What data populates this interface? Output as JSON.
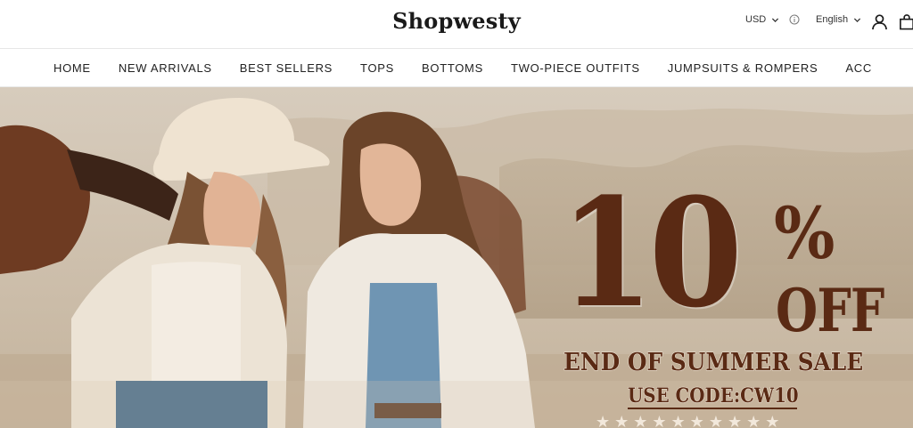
{
  "header": {
    "logo_text": "Shopwesty",
    "currency": "USD",
    "language": "English"
  },
  "nav": {
    "items": [
      {
        "label": "HOME"
      },
      {
        "label": "NEW ARRIVALS"
      },
      {
        "label": "BEST SELLERS"
      },
      {
        "label": "TOPS"
      },
      {
        "label": "BOTTOMS"
      },
      {
        "label": "TWO-PIECE OUTFITS"
      },
      {
        "label": "JUMPSUITS & ROMPERS"
      },
      {
        "label": "ACC"
      }
    ]
  },
  "hero": {
    "discount_number": "10",
    "discount_percent": "%",
    "discount_off": "OFF",
    "sale_text": "END OF SUMMER SALE",
    "code_text": "USE CODE:CW10",
    "stars": "★★★★★★★★★★",
    "promo_color": "#5a2a14"
  },
  "icons": {
    "info": "info-icon",
    "account": "account-icon",
    "cart": "cart-icon",
    "chevron": "chevron-down-icon"
  }
}
